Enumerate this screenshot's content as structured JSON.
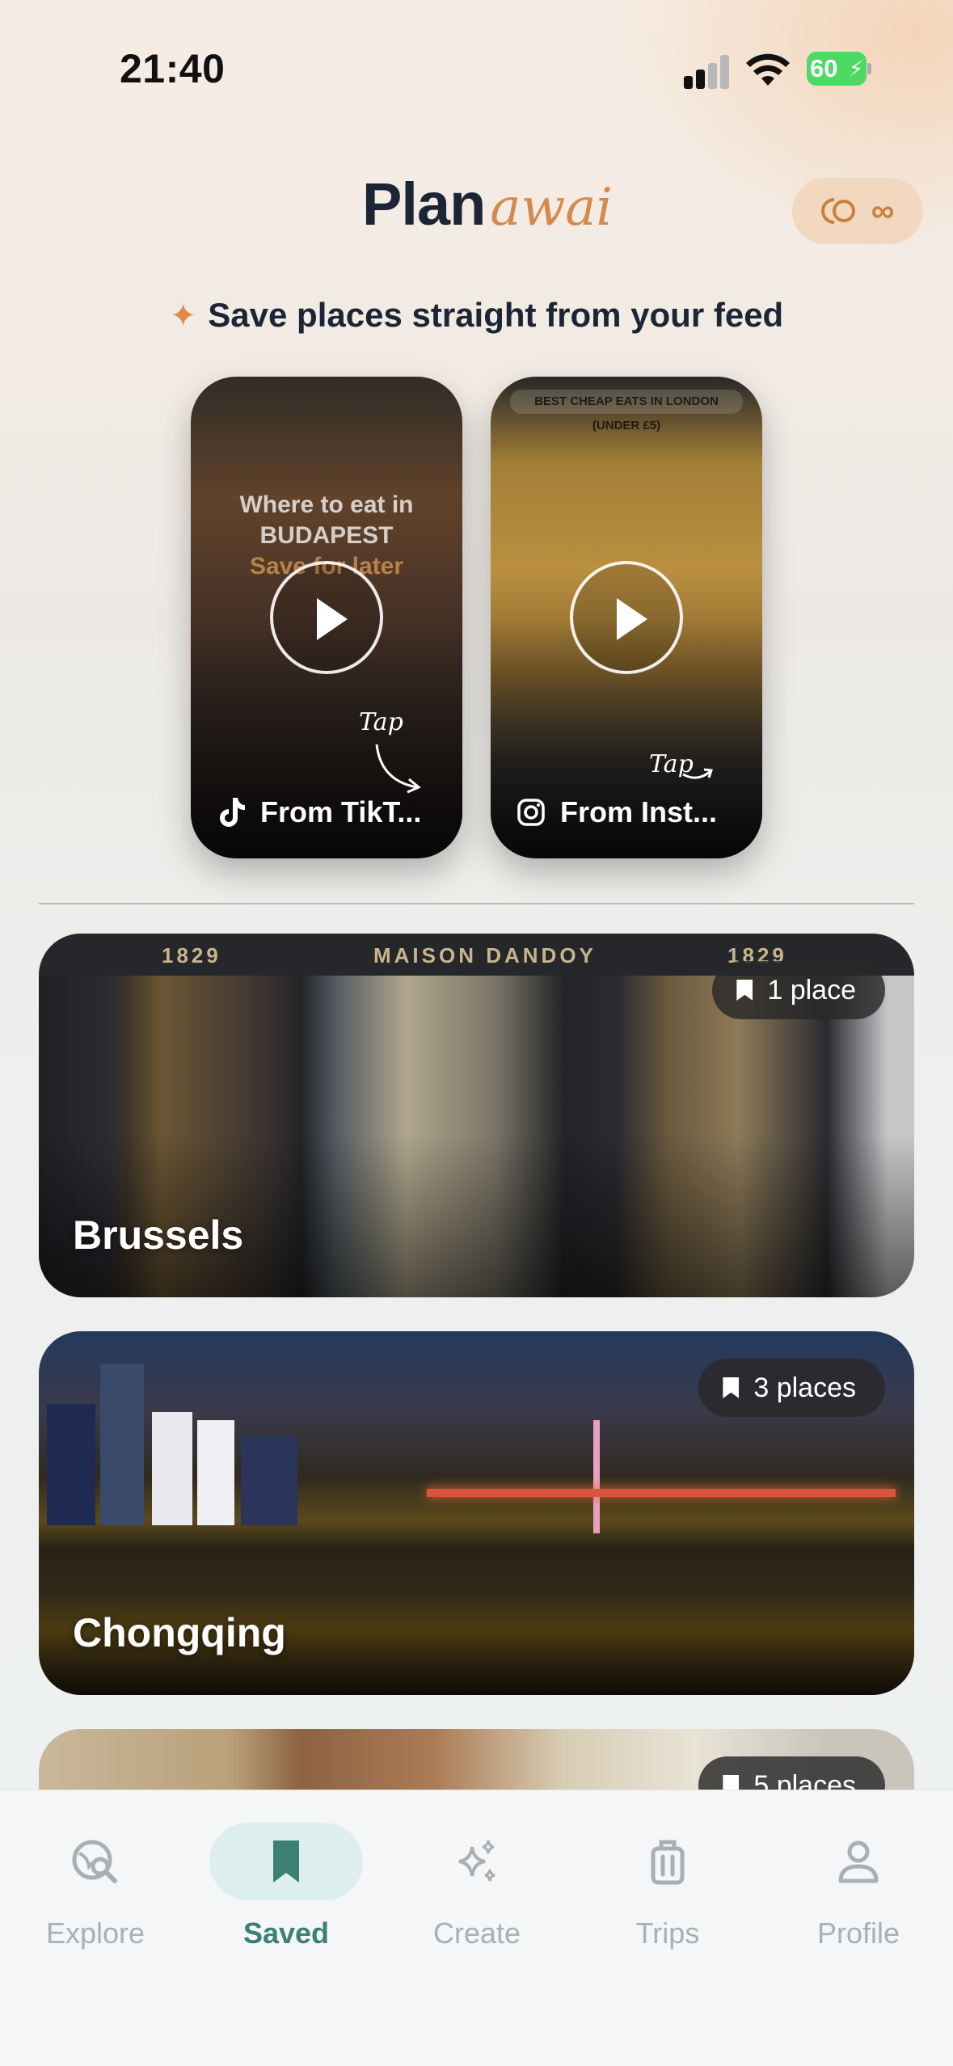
{
  "status_bar": {
    "time": "21:40",
    "battery_pct": "60"
  },
  "header": {
    "logo_plan": "Plan",
    "logo_awai": "awai",
    "pill_symbol": "∞"
  },
  "feed": {
    "title": "Save places straight from your feed",
    "cards": [
      {
        "source_label": "From TikT...",
        "source_icon": "tiktok-icon",
        "overlay_lines": [
          "Where to eat in",
          "BUDAPEST",
          "Save for later"
        ],
        "tap_hint": "Tap"
      },
      {
        "source_label": "From Inst...",
        "source_icon": "instagram-icon",
        "overlay_title": "BEST CHEAP EATS IN LONDON (UNDER £5)",
        "tap_hint": "Tap"
      }
    ]
  },
  "cities": [
    {
      "name": "Brussels",
      "places": "1 place",
      "sign_left": "1829",
      "sign_center": "MAISON DANDOY",
      "sign_right": "1829"
    },
    {
      "name": "Chongqing",
      "places": "3 places"
    },
    {
      "name": "",
      "places": "5 places"
    }
  ],
  "tabbar": {
    "tabs": [
      {
        "label": "Explore",
        "icon": "explore-icon",
        "active": false
      },
      {
        "label": "Saved",
        "icon": "bookmark-icon",
        "active": true
      },
      {
        "label": "Create",
        "icon": "sparkles-icon",
        "active": false
      },
      {
        "label": "Trips",
        "icon": "luggage-icon",
        "active": false
      },
      {
        "label": "Profile",
        "icon": "profile-icon",
        "active": false
      }
    ]
  },
  "colors": {
    "accent": "#d48a4c",
    "active_tab": "#3c7f73",
    "inactive_tab": "#a9b0b5"
  }
}
